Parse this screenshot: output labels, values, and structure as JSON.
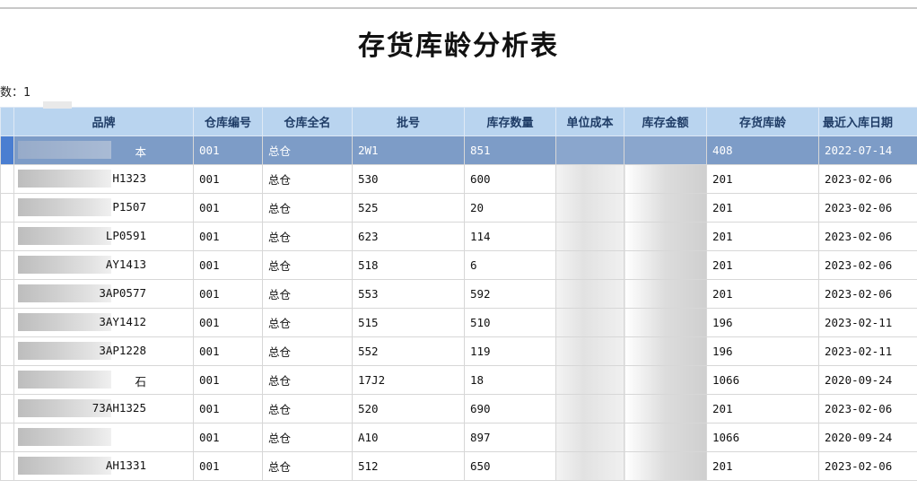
{
  "report": {
    "title": "存货库龄分析表",
    "meta_text": "数：1"
  },
  "columns": [
    "品牌",
    "仓库编号",
    "仓库全名",
    "批号",
    "库存数量",
    "单位成本",
    "库存金额",
    "存货库龄",
    "最近入库日期"
  ],
  "rows": [
    {
      "brand": "本",
      "wh_code": "001",
      "wh_name": "总仓",
      "batch": "2W1",
      "qty": "851",
      "age": "408",
      "last_in": "2022-07-14",
      "selected": true
    },
    {
      "brand": "H1323",
      "wh_code": "001",
      "wh_name": "总仓",
      "batch": "530",
      "qty": "600",
      "age": "201",
      "last_in": "2023-02-06"
    },
    {
      "brand": "P1507",
      "wh_code": "001",
      "wh_name": "总仓",
      "batch": "525",
      "qty": "20",
      "age": "201",
      "last_in": "2023-02-06"
    },
    {
      "brand": "LP0591",
      "wh_code": "001",
      "wh_name": "总仓",
      "batch": "623",
      "qty": "114",
      "age": "201",
      "last_in": "2023-02-06"
    },
    {
      "brand": "AY1413",
      "wh_code": "001",
      "wh_name": "总仓",
      "batch": "518",
      "qty": "6",
      "age": "201",
      "last_in": "2023-02-06"
    },
    {
      "brand": "3AP0577",
      "wh_code": "001",
      "wh_name": "总仓",
      "batch": "553",
      "qty": "592",
      "age": "201",
      "last_in": "2023-02-06"
    },
    {
      "brand": "3AY1412",
      "wh_code": "001",
      "wh_name": "总仓",
      "batch": "515",
      "qty": "510",
      "age": "196",
      "last_in": "2023-02-11"
    },
    {
      "brand": "3AP1228",
      "wh_code": "001",
      "wh_name": "总仓",
      "batch": "552",
      "qty": "119",
      "age": "196",
      "last_in": "2023-02-11"
    },
    {
      "brand": "石",
      "wh_code": "001",
      "wh_name": "总仓",
      "batch": "17J2",
      "qty": "18",
      "age": "1066",
      "last_in": "2020-09-24"
    },
    {
      "brand": "73AH1325",
      "wh_code": "001",
      "wh_name": "总仓",
      "batch": "520",
      "qty": "690",
      "age": "201",
      "last_in": "2023-02-06"
    },
    {
      "brand": "",
      "wh_code": "001",
      "wh_name": "总仓",
      "batch": "A10",
      "qty": "897",
      "age": "1066",
      "last_in": "2020-09-24"
    },
    {
      "brand": "AH1331",
      "wh_code": "001",
      "wh_name": "总仓",
      "batch": "512",
      "qty": "650",
      "age": "201",
      "last_in": "2023-02-06"
    }
  ]
}
